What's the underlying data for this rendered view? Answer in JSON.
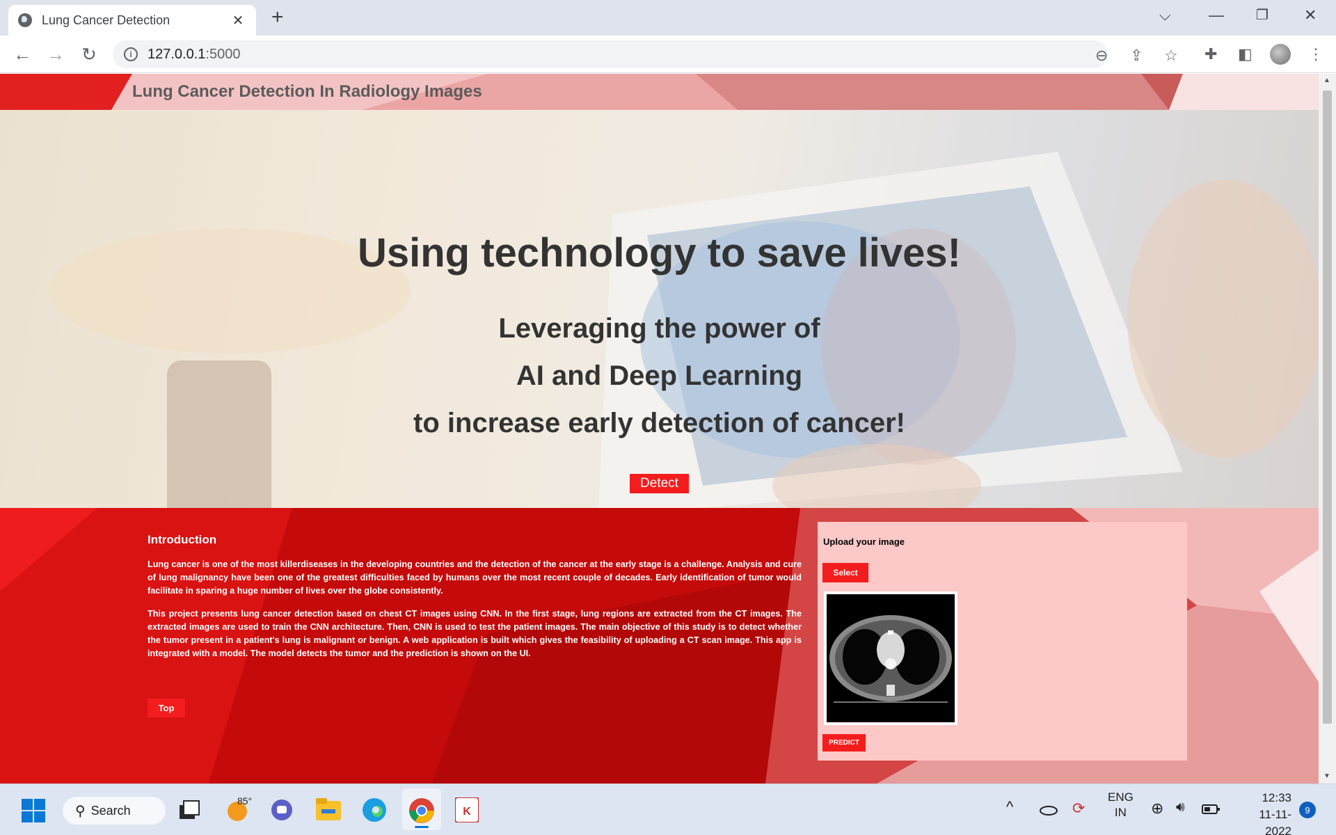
{
  "browser": {
    "tab_title": "Lung Cancer Detection",
    "url_host": "127.0.0.1",
    "url_port": ":5000"
  },
  "page": {
    "site_title": "Lung Cancer Detection In Radiology Images",
    "hero": {
      "headline": "Using technology to save lives!",
      "sub_lines": [
        "Leveraging the power of",
        "AI and Deep Learning",
        "to increase early detection of cancer!"
      ],
      "detect_label": "Detect"
    },
    "intro": {
      "heading": "Introduction",
      "paragraphs": [
        "Lung cancer is one of the most killerdiseases in the developing countries and the detection of the cancer at the early stage is a challenge. Analysis and cure of lung malignancy have been one of the greatest difficulties faced by humans over the most recent couple of decades. Early identification of tumor would facilitate in sparing a huge number of lives over the globe consistently.",
        "This project presents lung cancer detection based on chest CT images using CNN. In the first stage, lung regions are extracted from the CT images. The extracted images are used to train the CNN architecture. Then, CNN is used to test the patient images. The main objective of this study is to detect whether the tumor present in a patient's lung is malignant or benign. A web application is built which gives the feasibility of uploading a CT scan image. This app is integrated with a model. The model detects the tumor and the prediction is shown on the UI."
      ],
      "top_label": "Top"
    },
    "upload": {
      "title": "Upload your image",
      "select_label": "Select",
      "predict_label": "PREDICT"
    }
  },
  "taskbar": {
    "search_label": "Search",
    "weather_temp": "85°",
    "lang_line1": "ENG",
    "lang_line2": "IN",
    "time": "12:33",
    "date": "11-11-2022",
    "notification_count": "9"
  },
  "colors": {
    "accent_red": "#f41d1d",
    "section_red": "#c60d0d",
    "card_pink": "#fdc8c8"
  }
}
